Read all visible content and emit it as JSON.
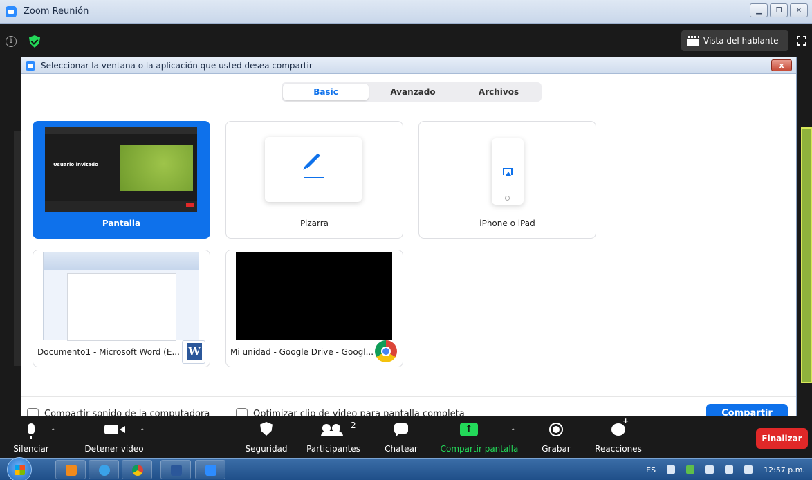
{
  "window": {
    "title": "Zoom Reunión"
  },
  "meeting": {
    "speaker_view": "Vista del hablante"
  },
  "dialog": {
    "title": "Seleccionar la ventana o la aplicación que usted desea compartir",
    "close_label": "x",
    "tabs": [
      "Basic",
      "Avanzado",
      "Archivos"
    ],
    "cards": {
      "screen": "Pantalla",
      "screen_thumb_text": "Usuario invitado",
      "whiteboard": "Pizarra",
      "iphone": "iPhone o iPad",
      "word": "Documento1 - Microsoft Word (E...",
      "drive": "Mi unidad - Google Drive - Googl..."
    },
    "share_sound": "Compartir sonido de la computadora",
    "optimize_video": "Optimizar clip de video para pantalla completa",
    "share_button": "Compartir"
  },
  "toolbar": {
    "mute": "Silenciar",
    "stop_video": "Detener video",
    "security": "Seguridad",
    "participants": "Participantes",
    "participants_count": "2",
    "chat": "Chatear",
    "share_screen": "Compartir pantalla",
    "record": "Grabar",
    "reactions": "Reacciones",
    "end": "Finalizar"
  },
  "taskbar": {
    "language": "ES",
    "time": "12:57 p.m."
  },
  "colors": {
    "accent": "#0e71eb",
    "green": "#23d959",
    "end_red": "#e02828"
  }
}
